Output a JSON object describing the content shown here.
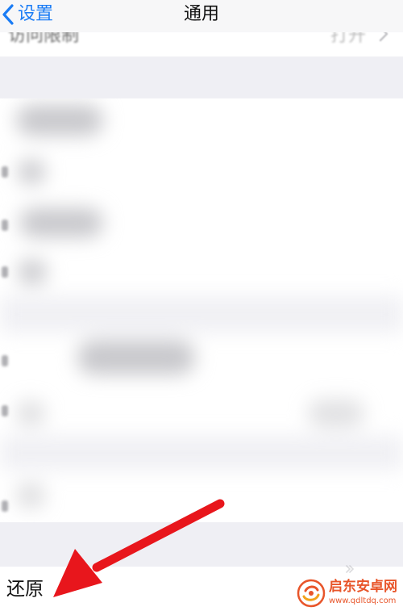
{
  "nav": {
    "back_label": "设置",
    "title": "通用"
  },
  "top_row": {
    "label": "访问限制",
    "value": "打开"
  },
  "restore_row": {
    "label": "还原"
  },
  "watermark": {
    "name": "启东安卓网",
    "url": "www.qdltdq.com"
  },
  "colors": {
    "accent_blue": "#1a7cf5",
    "arrow_red": "#e8161c",
    "watermark_orange": "#e8552a",
    "group_background": "#efeff4"
  }
}
